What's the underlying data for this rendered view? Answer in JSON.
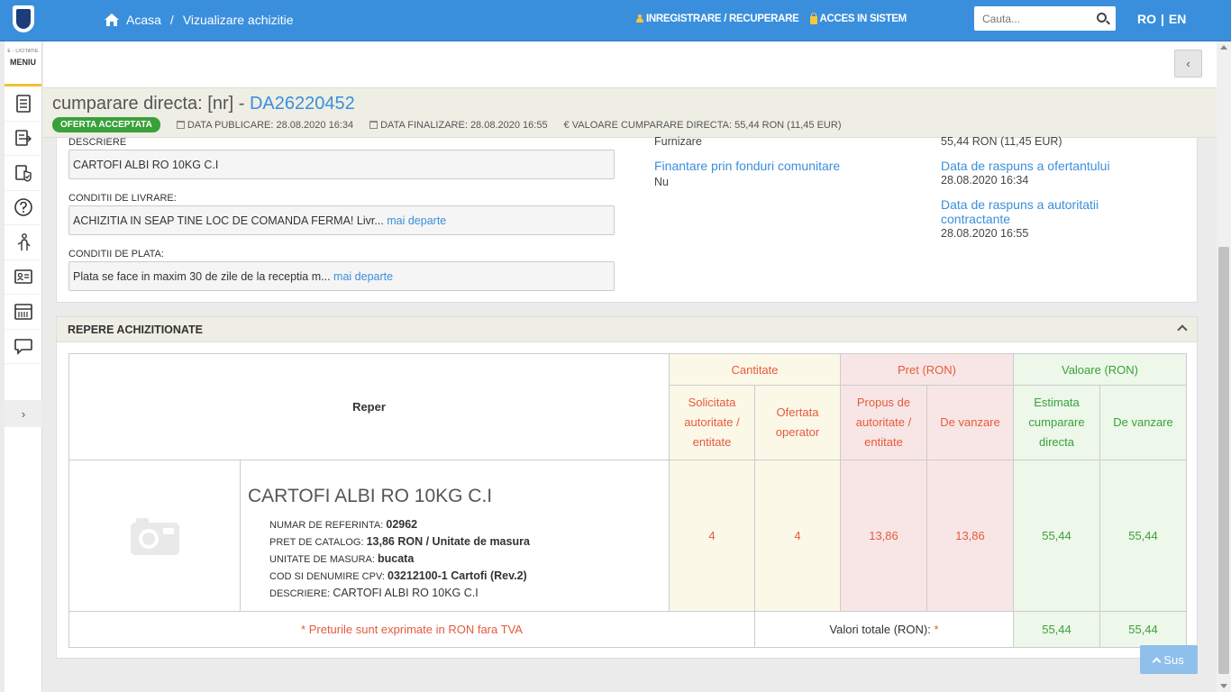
{
  "header": {
    "breadcrumb_home": "Acasa",
    "breadcrumb_sep": "/",
    "breadcrumb_current": "Vizualizare achizitie",
    "link_register": "INREGISTRARE / RECUPERARE",
    "link_login": "ACCES IN SISTEM",
    "search_placeholder": "Cauta...",
    "lang_ro": "RO",
    "lang_sep": "|",
    "lang_en": "EN"
  },
  "sidebar": {
    "small_label": "E - LICITATIE",
    "menu_label": "MENIU",
    "items": [
      "document-list-icon",
      "export-list-icon",
      "certificate-icon",
      "help-icon",
      "handshake-icon",
      "id-card-icon",
      "catalog-icon",
      "chat-icon"
    ]
  },
  "title": {
    "prefix": "cumparare directa: [nr] - ",
    "code": "DA26220452",
    "status": "OFERTA ACCEPTATA",
    "publish": "DATA PUBLICARE: 28.08.2020 16:34",
    "finish": "DATA FINALIZARE: 28.08.2020 16:55",
    "value": "€ VALOARE CUMPARARE DIRECTA: 55,44  RON (11,45  EUR)"
  },
  "details": {
    "desc_label": "DESCRIERE",
    "desc_value": "CARTOFI ALBI RO 10KG C.I",
    "delivery_label": "CONDITII DE LIVRARE:",
    "delivery_value": "ACHIZITIA IN SEAP TINE LOC DE COMANDA FERMA! Livr...",
    "payment_label": "CONDITII DE PLATA:",
    "payment_value": "Plata se face in maxim 30 de zile de la receptia m...",
    "more_link": "mai departe",
    "type_value": "Furnizare",
    "funds_label": "Finantare prin fonduri comunitare",
    "funds_value": "Nu",
    "amount_value": "55,44  RON (11,45  EUR)",
    "reply_bidder_label": "Data de raspuns a ofertantului",
    "reply_bidder_value": "28.08.2020 16:34",
    "reply_authority_label": "Data de raspuns a autoritatii contractante",
    "reply_authority_value": "28.08.2020 16:55"
  },
  "repere": {
    "heading": "REPERE ACHIZITIONATE",
    "col_reper": "Reper",
    "grp_qty": "Cantitate",
    "grp_price": "Pret (RON)",
    "grp_value": "Valoare (RON)",
    "sub_requested": "Solicitata autoritate / entitate",
    "sub_offered": "Ofertata operator",
    "sub_proposed": "Propus de autoritate / entitate",
    "sub_sale_price": "De vanzare",
    "sub_estimated": "Estimata cumparare directa",
    "sub_sale_value": "De vanzare",
    "product": {
      "name": "CARTOFI ALBI RO 10KG C.I",
      "ref_label": "NUMAR DE REFERINTA:",
      "ref_value": "02962",
      "catalog_label": "PRET DE CATALOG:",
      "catalog_value": "13,86  RON / Unitate de masura",
      "unit_label": "UNITATE DE MASURA:",
      "unit_value": "bucata",
      "cpv_label": "COD SI DENUMIRE CPV:",
      "cpv_value": "03212100-1 Cartofi (Rev.2)",
      "desc_label": "DESCRIERE:",
      "desc_value": "CARTOFI ALBI RO 10KG C.I",
      "qty_requested": "4",
      "qty_offered": "4",
      "price_proposed": "13,86",
      "price_sale": "13,86",
      "value_estimated": "55,44",
      "value_sale": "55,44"
    },
    "footnote": "* Preturile sunt exprimate in RON fara TVA",
    "total_label": "Valori totale (RON):",
    "total_star": "*",
    "total_estimated": "55,44",
    "total_sale": "55,44"
  },
  "scroll_top": "Sus",
  "colors": {
    "brand": "#3a8fdc",
    "success": "#3aa13a",
    "accent": "#e55a3c"
  }
}
